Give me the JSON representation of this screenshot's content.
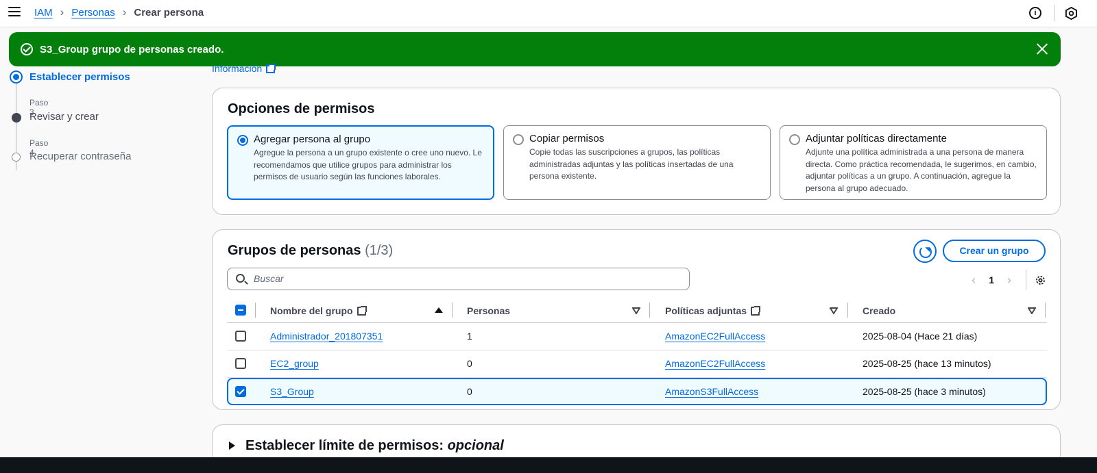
{
  "breadcrumb": {
    "root": "IAM",
    "parent": "Personas",
    "current": "Crear persona"
  },
  "flash": {
    "message": "S3_Group grupo de personas creado."
  },
  "steps": [
    {
      "sub": "",
      "title": "Establecer permisos",
      "state": "active"
    },
    {
      "sub": "Paso 3",
      "title": "Revisar y crear",
      "state": "pending"
    },
    {
      "sub": "Paso 4",
      "title": "Recuperar contraseña",
      "state": "disabled"
    }
  ],
  "info_link": "Información",
  "permissions": {
    "title": "Opciones de permisos",
    "options": [
      {
        "title": "Agregar persona al grupo",
        "desc": "Agregue la persona a un grupo existente o cree uno nuevo. Le recomendamos que utilice grupos para administrar los permisos de usuario según las funciones laborales.",
        "selected": true
      },
      {
        "title": "Copiar permisos",
        "desc": "Copie todas las suscripciones a grupos, las políticas administradas adjuntas y las políticas insertadas de una persona existente.",
        "selected": false
      },
      {
        "title": "Adjuntar políticas directamente",
        "desc": "Adjunte una política administrada a una persona de manera directa. Como práctica recomendada, le sugerimos, en cambio, adjuntar políticas a un grupo. A continuación, agregue la persona al grupo adecuado.",
        "selected": false
      }
    ]
  },
  "groups": {
    "title": "Grupos de personas",
    "count": "(1/3)",
    "create_button": "Crear un grupo",
    "search_placeholder": "Buscar",
    "page": "1",
    "columns": {
      "name": "Nombre del grupo",
      "persons": "Personas",
      "policies": "Políticas adjuntas",
      "created": "Creado"
    },
    "rows": [
      {
        "name": "Administrador_201807351",
        "persons": "1",
        "policy": "AmazonEC2FullAccess",
        "created": "2025-08-04 (Hace 21 días)",
        "checked": false
      },
      {
        "name": "EC2_group",
        "persons": "0",
        "policy": "AmazonEC2FullAccess",
        "created": "2025-08-25 (hace 13 minutos)",
        "checked": false
      },
      {
        "name": "S3_Group",
        "persons": "0",
        "policy": "AmazonS3FullAccess",
        "created": "2025-08-25 (hace 3 minutos)",
        "checked": true
      }
    ]
  },
  "boundary": {
    "title": "Establecer límite de permisos:",
    "optional": "opcional"
  },
  "colors": {
    "primary": "#006ce0",
    "success": "#037f0c",
    "text": "#0f141a"
  }
}
